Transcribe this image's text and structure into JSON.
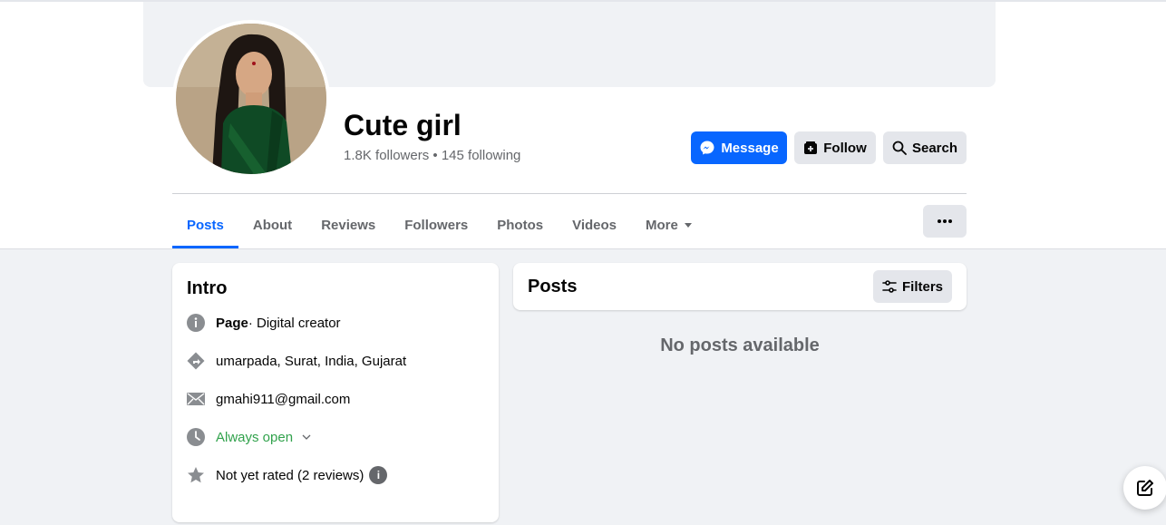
{
  "profile": {
    "name": "Cute girl",
    "followers": "1.8K followers",
    "separator": "•",
    "following": "145 following"
  },
  "actions": {
    "message": "Message",
    "follow": "Follow",
    "search": "Search"
  },
  "tabs": [
    {
      "label": "Posts",
      "active": true
    },
    {
      "label": "About"
    },
    {
      "label": "Reviews"
    },
    {
      "label": "Followers"
    },
    {
      "label": "Photos"
    },
    {
      "label": "Videos"
    },
    {
      "label": "More"
    }
  ],
  "intro": {
    "title": "Intro",
    "page_label": "Page",
    "page_category": " · Digital creator",
    "location": "umarpada, Surat, India, Gujarat",
    "email": "gmahi911@gmail.com",
    "hours": "Always open",
    "rating": "Not yet rated (2 reviews)"
  },
  "posts": {
    "title": "Posts",
    "filters": "Filters",
    "empty": "No posts available"
  },
  "colors": {
    "accent": "#0866ff",
    "green": "#31a24c",
    "secondary_text": "#65676b"
  }
}
